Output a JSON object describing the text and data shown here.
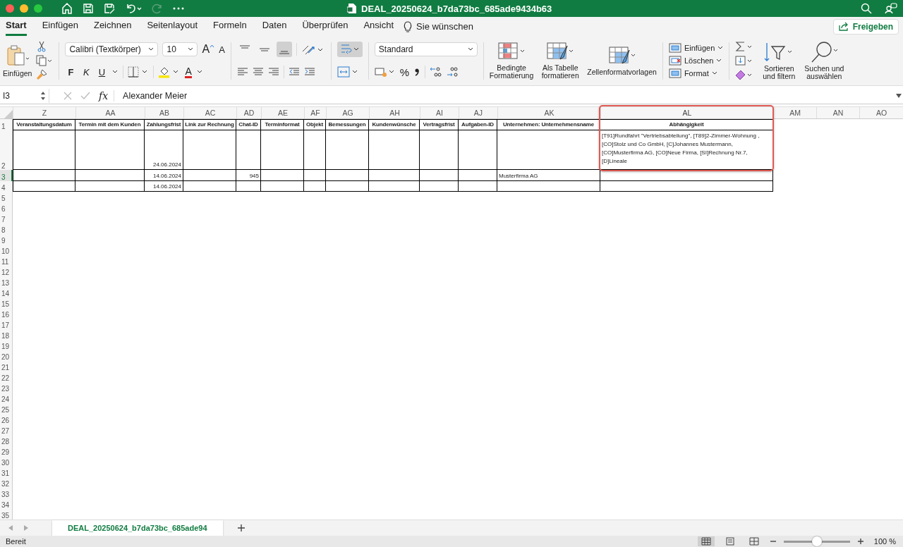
{
  "window": {
    "title": "DEAL_20250624_b7da73bc_685ade9434b63"
  },
  "ribbon_tabs": [
    {
      "label": "Start",
      "selected": true
    },
    {
      "label": "Einfügen",
      "selected": false
    },
    {
      "label": "Zeichnen",
      "selected": false
    },
    {
      "label": "Seitenlayout",
      "selected": false
    },
    {
      "label": "Formeln",
      "selected": false
    },
    {
      "label": "Daten",
      "selected": false
    },
    {
      "label": "Überprüfen",
      "selected": false
    },
    {
      "label": "Ansicht",
      "selected": false
    }
  ],
  "tell_me": "Sie wünschen",
  "share_button": "Freigeben",
  "clipboard": {
    "paste": "Einfügen"
  },
  "font": {
    "name": "Calibri (Textkörper)",
    "size": "10",
    "grow": "A",
    "shrink": "A",
    "bold": "F",
    "italic": "K",
    "underline": "U",
    "font_color_letter": "A"
  },
  "alignment": {
    "top_pressed": false,
    "middle_pressed": false,
    "bottom_pressed": true,
    "wrap_pressed": true
  },
  "number": {
    "format": "Standard",
    "percent": "%"
  },
  "styles": [
    {
      "lines": [
        "Bedingte",
        "Formatierung"
      ]
    },
    {
      "lines": [
        "Als Tabelle",
        "formatieren"
      ]
    },
    {
      "lines": [
        "Zellenformatvorlagen"
      ]
    }
  ],
  "cell_commands": [
    "Einfügen",
    "Löschen",
    "Format"
  ],
  "editing": [
    {
      "lines": [
        "Sortieren",
        "und filtern"
      ]
    },
    {
      "lines": [
        "Suchen und",
        "auswählen"
      ]
    }
  ],
  "formula_bar": {
    "name_box": "I3",
    "fx": "fx",
    "value": "Alexander Meier"
  },
  "columns": [
    {
      "letter": "Z",
      "header": "Veranstaltungsdatum",
      "highlighted": false
    },
    {
      "letter": "AA",
      "header": "Termin mit dem Kunden",
      "highlighted": false
    },
    {
      "letter": "AB",
      "header": "Zahlungsfrist",
      "highlighted": false
    },
    {
      "letter": "AC",
      "header": "Link zur Rechnung",
      "highlighted": false
    },
    {
      "letter": "AD",
      "header": "Chat-ID",
      "highlighted": false
    },
    {
      "letter": "AE",
      "header": "Terminformat",
      "highlighted": false
    },
    {
      "letter": "AF",
      "header": "Objekt",
      "highlighted": false
    },
    {
      "letter": "AG",
      "header": "Bemessungen",
      "highlighted": false
    },
    {
      "letter": "AH",
      "header": "Kundenwünsche",
      "highlighted": false
    },
    {
      "letter": "AI",
      "header": "Vertragsfrist",
      "highlighted": false
    },
    {
      "letter": "AJ",
      "header": "Aufgaben-ID",
      "highlighted": false
    },
    {
      "letter": "AK",
      "header": "Unternehmen: Unternehmensname",
      "highlighted": false
    },
    {
      "letter": "AL",
      "header": "Abhängigkeit",
      "highlighted": true
    },
    {
      "letter": "AM",
      "highlighted": false
    },
    {
      "letter": "AN",
      "highlighted": false
    },
    {
      "letter": "AO",
      "highlighted": false
    }
  ],
  "header_row_number": "1",
  "rows": [
    {
      "number": "2",
      "selected": false,
      "cells": [
        null,
        null,
        {
          "text": "24.06.2024",
          "kind": "number"
        },
        null,
        null,
        null,
        null,
        null,
        null,
        null,
        null,
        null,
        {
          "text": "[T91]Rundfahrt \"Vertriebsabteilung\", [T89]2-Zimmer-Wohnung , [CO]Stolz und Co GmbH, [C]Johannes Mustermann, [CO]Musterfirma AG, [CO]Neue Firma, [SI]Rechnung Nr.7, [D]Lineale",
          "kind": "wrapped"
        }
      ]
    },
    {
      "number": "3",
      "selected": true,
      "cells": [
        null,
        null,
        {
          "text": "14.06.2024",
          "kind": "number"
        },
        null,
        {
          "text": "945",
          "kind": "number"
        },
        null,
        null,
        null,
        null,
        null,
        null,
        {
          "text": "Musterfirma AG",
          "kind": "text"
        },
        null
      ]
    },
    {
      "number": "4",
      "selected": false,
      "cells": [
        null,
        null,
        {
          "text": "14.06.2024",
          "kind": "number"
        },
        null,
        null,
        null,
        null,
        null,
        null,
        null,
        null,
        null,
        null
      ]
    }
  ],
  "more_row_numbers": [
    "5",
    "6",
    "7",
    "8",
    "9",
    "10",
    "11",
    "12",
    "13",
    "14",
    "15",
    "16",
    "17",
    "18",
    "19",
    "20",
    "21",
    "22",
    "23",
    "24",
    "25",
    "26",
    "27",
    "28",
    "29",
    "30",
    "31",
    "32",
    "33",
    "34",
    "35"
  ],
  "sheet_tabs": [
    {
      "label": "DEAL_20250624_b7da73bc_685ade94",
      "selected": true
    }
  ],
  "status_bar": {
    "status": "Bereit",
    "zoom": {
      "level": 0.5,
      "reading": "100 %"
    }
  }
}
